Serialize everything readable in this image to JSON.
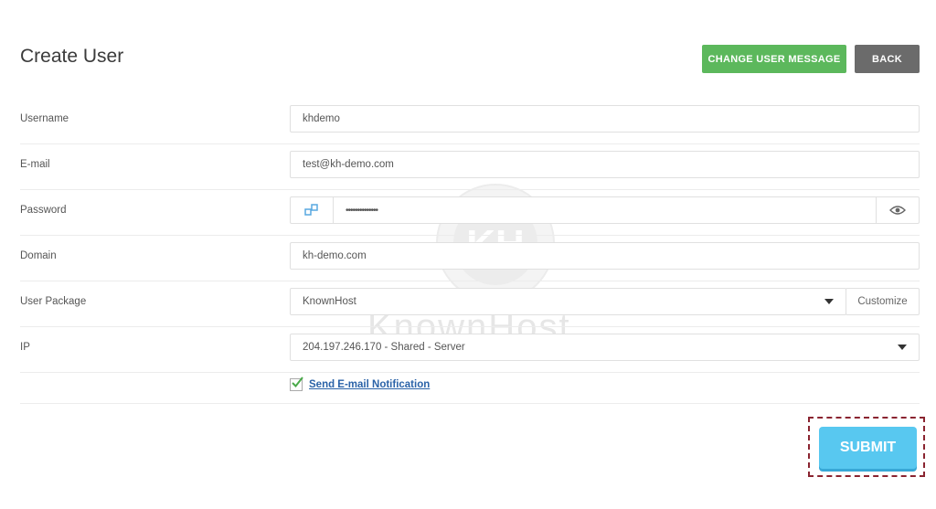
{
  "page": {
    "title": "Create User"
  },
  "header_buttons": {
    "change_message": "CHANGE USER MESSAGE",
    "back": "BACK"
  },
  "form": {
    "username": {
      "label": "Username",
      "value": "khdemo"
    },
    "email": {
      "label": "E-mail",
      "value": "test@kh-demo.com"
    },
    "password": {
      "label": "Password",
      "value": "••••••••••••••"
    },
    "domain": {
      "label": "Domain",
      "value": "kh-demo.com"
    },
    "package": {
      "label": "User Package",
      "value": "KnownHost",
      "customize": "Customize"
    },
    "ip": {
      "label": "IP",
      "value": "204.197.246.170 - Shared - Server"
    },
    "notification": {
      "label": "Send E-mail Notification",
      "checked": true
    }
  },
  "submit": {
    "label": "SUBMIT"
  },
  "watermark": {
    "text": "KnownHost",
    "logo_text": "KH"
  },
  "colors": {
    "green": "#5cb85c",
    "gray": "#6b6b6b",
    "submit": "#58c8f0",
    "link": "#2b63a8",
    "highlight": "#8a2430"
  }
}
